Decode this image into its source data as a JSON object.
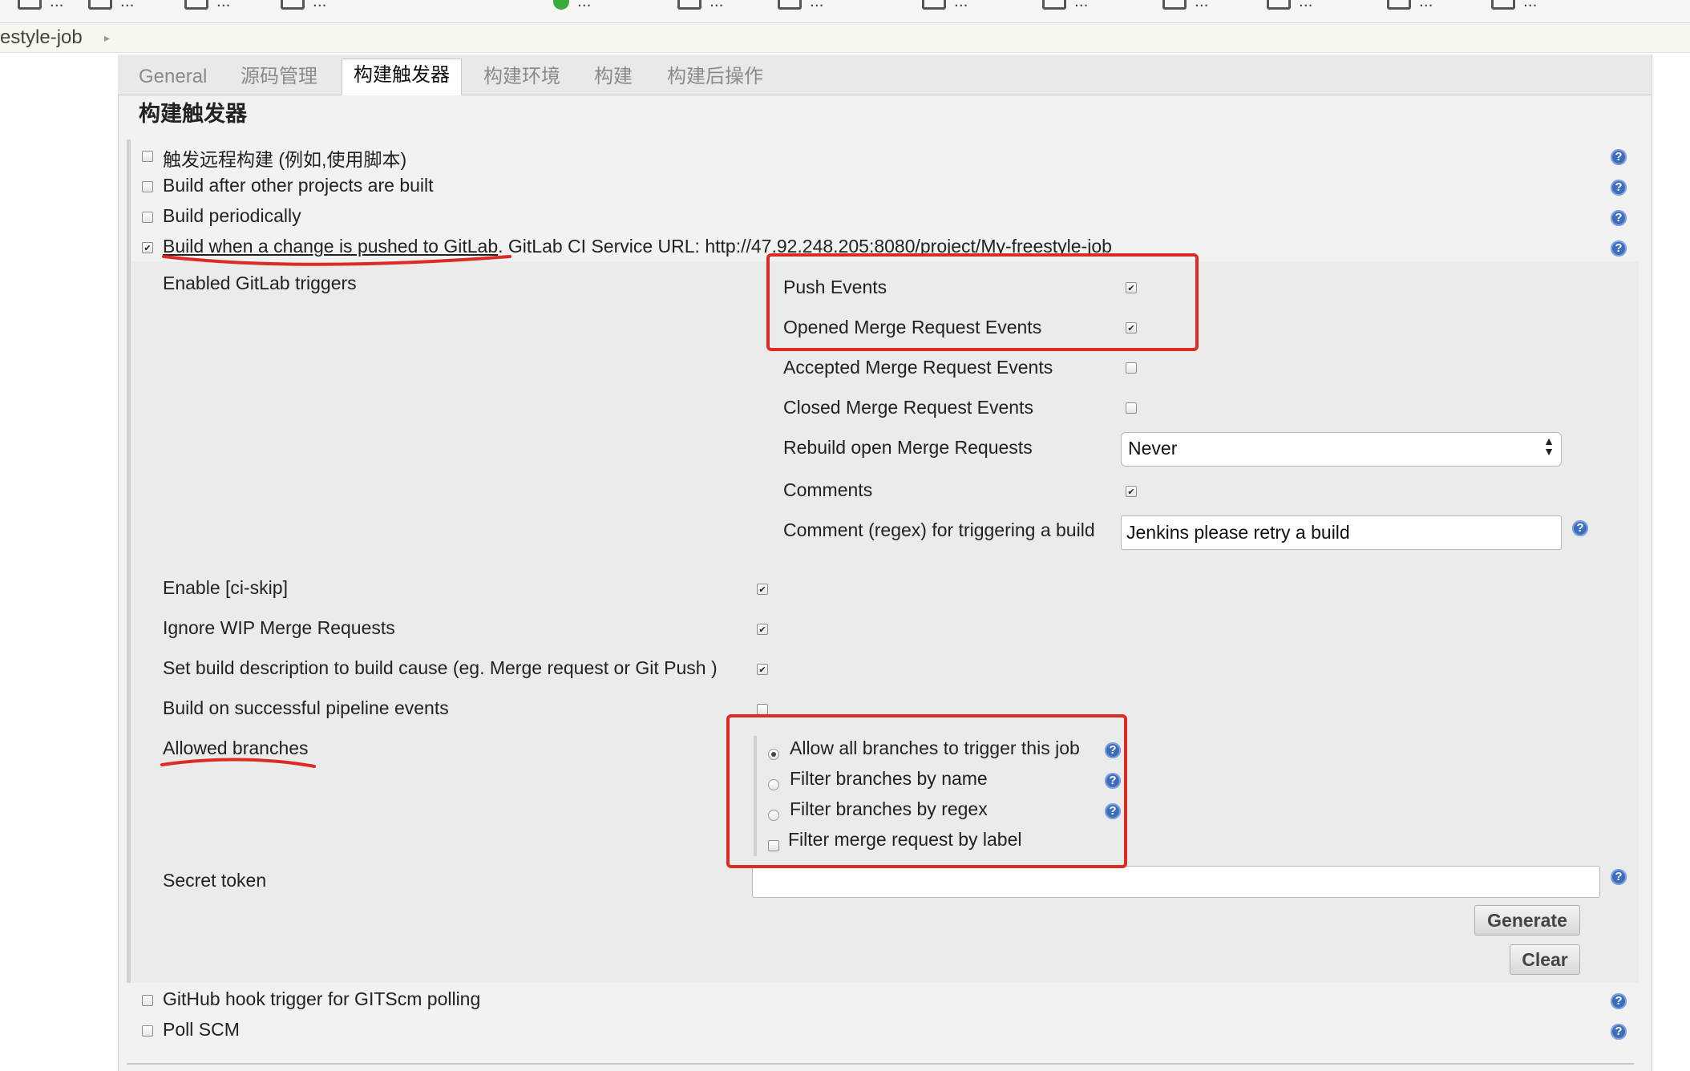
{
  "bookmarks": [
    {
      "label": "...",
      "type": "folder"
    },
    {
      "label": "...",
      "type": "folder"
    },
    {
      "label": "...",
      "type": "folder"
    },
    {
      "label": "...",
      "type": "folder"
    },
    {
      "label": "...",
      "type": "circle"
    },
    {
      "label": "...",
      "type": "folder"
    },
    {
      "label": "...",
      "type": "folder"
    },
    {
      "label": "...",
      "type": "folder"
    },
    {
      "label": "...",
      "type": "folder"
    },
    {
      "label": "...",
      "type": "folder"
    },
    {
      "label": "...",
      "type": "folder"
    },
    {
      "label": "...",
      "type": "folder"
    },
    {
      "label": "...",
      "type": "folder"
    }
  ],
  "breadcrumb": {
    "job": "estyle-job",
    "arrow": "▸"
  },
  "tabs": [
    "General",
    "源码管理",
    "构建触发器",
    "构建环境",
    "构建",
    "构建后操作"
  ],
  "active_tab": "构建触发器",
  "section_title": "构建触发器",
  "triggers": {
    "remote": {
      "label": "触发远程构建 (例如,使用脚本)",
      "checked": false
    },
    "after_other": {
      "label": "Build after other projects are built",
      "checked": false
    },
    "periodically": {
      "label": "Build periodically",
      "checked": false
    },
    "gitlab": {
      "label": "Build when a change is pushed to GitLab",
      "suffix": ". GitLab CI Service URL: http://47.92.248.205:8080/project/My-freestyle-job",
      "checked": true
    },
    "github_hook": {
      "label": "GitHub hook trigger for GITScm polling",
      "checked": false
    },
    "poll_scm": {
      "label": "Poll SCM",
      "checked": false
    }
  },
  "gitlab": {
    "enabled_triggers_label": "Enabled GitLab triggers",
    "push_events": {
      "label": "Push Events",
      "checked": true
    },
    "opened_mr": {
      "label": "Opened Merge Request Events",
      "checked": true
    },
    "accepted_mr": {
      "label": "Accepted Merge Request Events",
      "checked": false
    },
    "closed_mr": {
      "label": "Closed Merge Request Events",
      "checked": false
    },
    "rebuild_open_mr": {
      "label": "Rebuild open Merge Requests",
      "value": "Never"
    },
    "comments": {
      "label": "Comments",
      "checked": true
    },
    "comment_regex": {
      "label": "Comment (regex) for triggering a build",
      "value": "Jenkins please retry a build"
    },
    "ci_skip": {
      "label": "Enable [ci-skip]",
      "checked": true
    },
    "ignore_wip": {
      "label": "Ignore WIP Merge Requests",
      "checked": true
    },
    "set_description": {
      "label": "Set build description to build cause (eg. Merge request or Git Push )",
      "checked": true
    },
    "pipeline_events": {
      "label": "Build on successful pipeline events",
      "checked": false
    },
    "allowed_branches": {
      "label": "Allowed branches",
      "options": [
        {
          "label": "Allow all branches to trigger this job",
          "selected": true
        },
        {
          "label": "Filter branches by name",
          "selected": false
        },
        {
          "label": "Filter branches by regex",
          "selected": false
        }
      ],
      "mr_label_filter": {
        "label": "Filter merge request by label",
        "checked": false
      }
    },
    "secret_token": {
      "label": "Secret token",
      "value": ""
    },
    "generate_label": "Generate",
    "clear_label": "Clear"
  },
  "colors": {
    "annotation_red": "#dc2a24",
    "help_blue": "#3d6dbb",
    "panel_bg": "#f2f2f2"
  },
  "icons": {
    "help": "help-icon",
    "checkmark": "check-icon"
  }
}
